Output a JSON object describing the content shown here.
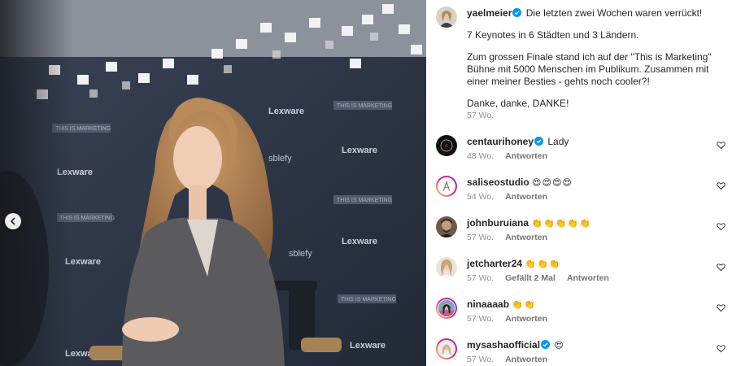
{
  "post": {
    "author": "yaelmeier",
    "caption_lines": [
      "Die letzten zwei Wochen waren verrückt!",
      "7 Keynotes in 6 Städten und 3 Ländern.",
      "Zum grossen Finale stand ich auf der \"This is Marketing\" Bühne mit 5000 Menschen im Publikum. Zusammen mit einer meiner Besties - gehts noch cooler?!",
      "Danke, danke, DANKE!"
    ],
    "time": "57 Wo."
  },
  "media": {
    "wall_logos": [
      "Lexware",
      "THIS IS MARKETING",
      "sblefy"
    ],
    "prev_label": "previous image"
  },
  "comments": [
    {
      "user": "centaurihoney",
      "verified": true,
      "text": "Lady",
      "time": "48 Wo.",
      "likes": "",
      "reply": "Antworten"
    },
    {
      "user": "saliseostudio",
      "verified": false,
      "text": "😍😍😍😍",
      "time": "54 Wo.",
      "likes": "",
      "reply": "Antworten"
    },
    {
      "user": "johnburuiana",
      "verified": false,
      "text": "👏👏👏👏👏",
      "time": "57 Wo.",
      "likes": "",
      "reply": "Antworten"
    },
    {
      "user": "jetcharter24",
      "verified": false,
      "text": "👏👏👏",
      "time": "57 Wo.",
      "likes": "Gefällt 2 Mal",
      "reply": "Antworten"
    },
    {
      "user": "ninaaaab",
      "verified": false,
      "text": "👏👏",
      "time": "57 Wo.",
      "likes": "",
      "reply": "Antworten"
    },
    {
      "user": "mysashaofficial",
      "verified": true,
      "text": "😍",
      "time": "57 Wo.",
      "likes": "",
      "reply": "Antworten"
    }
  ],
  "colors": {
    "verified": "#0095f6",
    "story_ring": "#d62976",
    "muted": "#8e8e8e"
  },
  "icons": {
    "verified": "verified-badge-icon",
    "like": "heart-icon",
    "prev": "chevron-left-icon"
  }
}
